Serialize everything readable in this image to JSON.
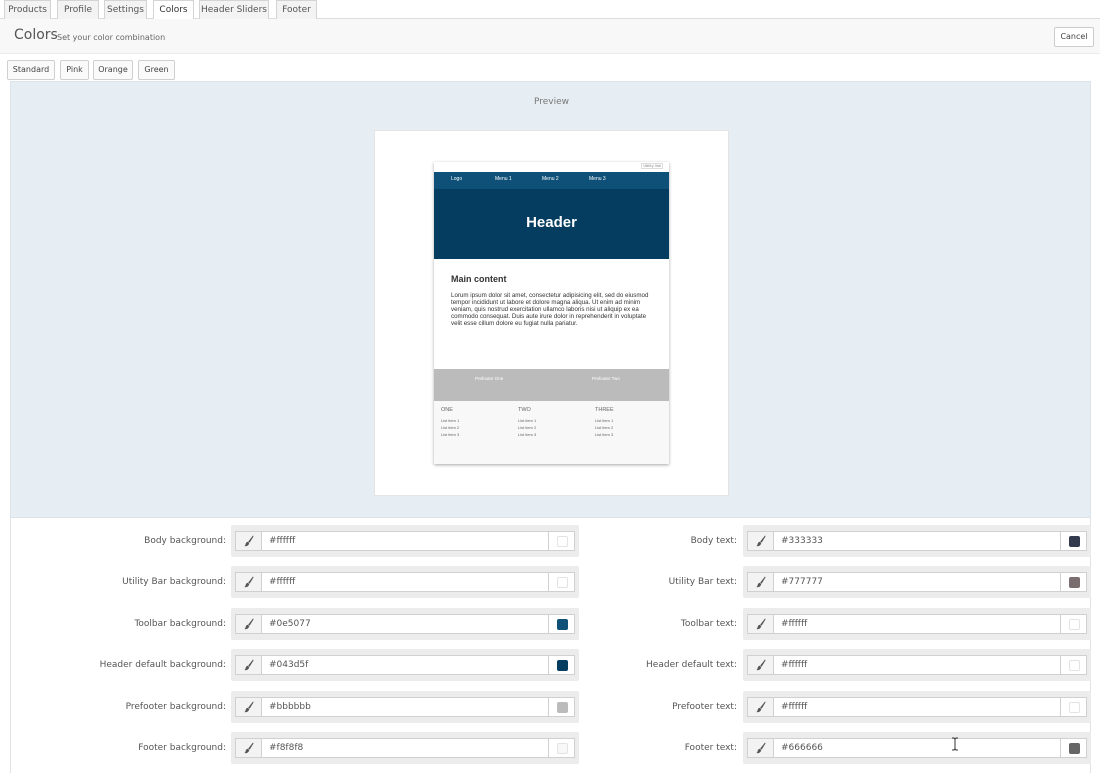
{
  "tabs": [
    {
      "label": "Products"
    },
    {
      "label": "Profile"
    },
    {
      "label": "Settings"
    },
    {
      "label": "Colors",
      "active": true
    },
    {
      "label": "Header Sliders"
    },
    {
      "label": "Footer"
    }
  ],
  "header": {
    "title": "Colors",
    "subtitle": "Set your color combination",
    "cancel_label": "Cancel"
  },
  "presets": [
    "Standard",
    "Pink",
    "Orange",
    "Green"
  ],
  "preview": {
    "label": "Preview",
    "utility_link": "Utility link",
    "menu": [
      "Logo",
      "Menu 1",
      "Menu 2",
      "Menu 3"
    ],
    "header_text": "Header",
    "main_title": "Main content",
    "main_body": "Lorum ipsum dolor sit amet, consectetur adipisicing elit, sed do eiusmod tempor incididunt ut labore et dolore magna aliqua. Ut enim ad minim veniam, quis nostrud exercitation ullamco laboris nisi ut aliquip ex ea commodo consequat. Duis aute irure dolor in reprehenderit in voluptate velit esse cillum dolore eu fugiat nulla pariatur.",
    "prefooter": [
      "Prefooter One",
      "Prefooter Two"
    ],
    "footer_columns": [
      {
        "title": "ONE",
        "items": [
          "List item 1",
          "List item 2",
          "List item 3"
        ]
      },
      {
        "title": "TWO",
        "items": [
          "List item 1",
          "List item 2",
          "List item 3"
        ]
      },
      {
        "title": "THREE",
        "items": [
          "List item 1",
          "List item 2",
          "List item 3"
        ]
      }
    ]
  },
  "colors": {
    "body_background": {
      "label": "Body background:",
      "value": "#ffffff"
    },
    "body_text": {
      "label": "Body text:",
      "value": "#333333"
    },
    "utility_bar_background": {
      "label": "Utility Bar background:",
      "value": "#ffffff"
    },
    "utility_bar_text": {
      "label": "Utility Bar text:",
      "value": "#777777"
    },
    "toolbar_background": {
      "label": "Toolbar background:",
      "value": "#0e5077"
    },
    "toolbar_text": {
      "label": "Toolbar text:",
      "value": "#ffffff"
    },
    "header_default_background": {
      "label": "Header default background:",
      "value": "#043d5f"
    },
    "header_default_text": {
      "label": "Header default text:",
      "value": "#ffffff"
    },
    "prefooter_background": {
      "label": "Prefooter background:",
      "value": "#bbbbbb"
    },
    "prefooter_text": {
      "label": "Prefooter text:",
      "value": "#ffffff"
    },
    "footer_background": {
      "label": "Footer background:",
      "value": "#f8f8f8"
    },
    "footer_text": {
      "label": "Footer text:",
      "value": "#666666"
    }
  },
  "icons": {
    "brush": "brush-icon",
    "cursor": "text-cursor-icon"
  }
}
